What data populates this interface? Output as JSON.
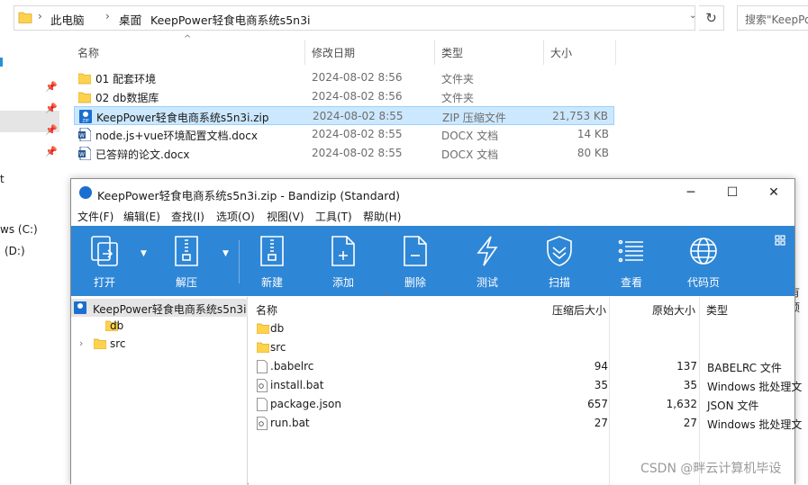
{
  "explorer": {
    "breadcrumb": [
      "此电脑",
      "桌面",
      "KeepPower轻食电商系统s5n3i"
    ],
    "search_placeholder": "搜索\"KeepPo",
    "nav_texts": [
      "t",
      "ws (C:)",
      "(D:)"
    ],
    "columns": {
      "name": "名称",
      "date": "修改日期",
      "type": "类型",
      "size": "大小"
    },
    "files": [
      {
        "name": "01  配套环境",
        "date": "2024-08-02 8:56",
        "type": "文件夹",
        "size": ""
      },
      {
        "name": "02 db数据库",
        "date": "2024-08-02 8:56",
        "type": "文件夹",
        "size": ""
      },
      {
        "name": "KeepPower轻食电商系统s5n3i.zip",
        "date": "2024-08-02 8:55",
        "type": "ZIP 压缩文件",
        "size": "21,753 KB"
      },
      {
        "name": "node.js+vue环境配置文档.docx",
        "date": "2024-08-02 8:55",
        "type": "DOCX 文档",
        "size": "14 KB"
      },
      {
        "name": "已答辩的论文.docx",
        "date": "2024-08-02 8:55",
        "type": "DOCX 文档",
        "size": "80 KB"
      }
    ],
    "right_edge_text": "有预"
  },
  "bandizip": {
    "title": "KeepPower轻食电商系统s5n3i.zip - Bandizip (Standard)",
    "menus": [
      "文件(F)",
      "编辑(E)",
      "查找(I)",
      "选项(O)",
      "视图(V)",
      "工具(T)",
      "帮助(H)"
    ],
    "toolbar": [
      "打开",
      "解压",
      "新建",
      "添加",
      "删除",
      "测试",
      "扫描",
      "查看",
      "代码页"
    ],
    "tree": {
      "root": "KeepPower轻食电商系统s5n3i",
      "children": [
        "db",
        "src"
      ]
    },
    "list_columns": {
      "name": "名称",
      "packed": "压缩后大小",
      "original": "原始大小",
      "type": "类型"
    },
    "entries": [
      {
        "name": "db",
        "packed": "",
        "original": "",
        "type": "",
        "icon": "folder-icon"
      },
      {
        "name": "src",
        "packed": "",
        "original": "",
        "type": "",
        "icon": "folder-icon"
      },
      {
        "name": ".babelrc",
        "packed": "94",
        "original": "137",
        "type": "BABELRC 文件",
        "icon": "file-icon"
      },
      {
        "name": "install.bat",
        "packed": "35",
        "original": "35",
        "type": "Windows 批处理文",
        "icon": "batch-file-icon"
      },
      {
        "name": "package.json",
        "packed": "657",
        "original": "1,632",
        "type": "JSON 文件",
        "icon": "file-icon"
      },
      {
        "name": "run.bat",
        "packed": "27",
        "original": "27",
        "type": "Windows 批处理文",
        "icon": "batch-file-icon"
      }
    ]
  },
  "watermark": "CSDN @畔云计算机毕设",
  "colors": {
    "toolbar_blue": "#2e86d6",
    "selection": "#cce8ff",
    "folder": "#ffd24d"
  }
}
